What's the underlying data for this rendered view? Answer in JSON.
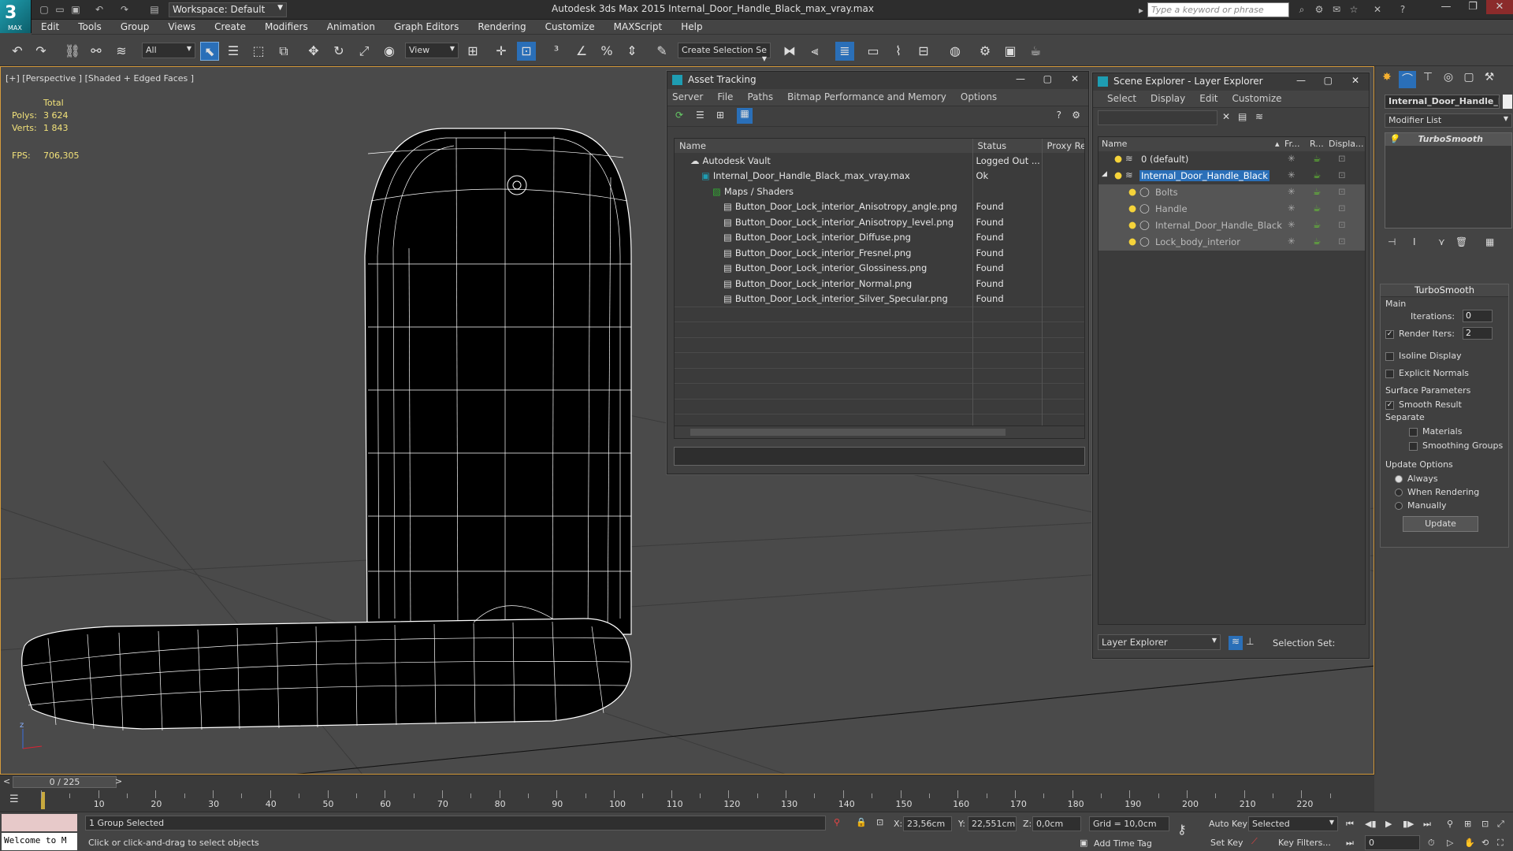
{
  "app": {
    "logo_text": "3",
    "logo_sub": "MAX",
    "title": "Autodesk 3ds Max  2015    Internal_Door_Handle_Black_max_vray.max",
    "workspace": "Workspace: Default",
    "search_placeholder": "Type a keyword or phrase"
  },
  "menubar": [
    "Edit",
    "Tools",
    "Group",
    "Views",
    "Create",
    "Modifiers",
    "Animation",
    "Graph Editors",
    "Rendering",
    "Customize",
    "MAXScript",
    "Help"
  ],
  "toolbar": {
    "filter_value": "All",
    "refcoord_value": "View",
    "selection_set_value": "Create Selection Se"
  },
  "viewport": {
    "label": "[+] [Perspective ] [Shaded + Edged Faces ]",
    "stats_header": "Total",
    "polys_label": "Polys:",
    "polys_value": "3 624",
    "verts_label": "Verts:",
    "verts_value": "1 843",
    "fps_label": "FPS:",
    "fps_value": "706,305"
  },
  "asset_tracking": {
    "title": "Asset Tracking",
    "menu": [
      "Server",
      "File",
      "Paths",
      "Bitmap Performance and Memory",
      "Options"
    ],
    "columns": [
      "Name",
      "Status",
      "Proxy Res"
    ],
    "rows": [
      {
        "name": "Autodesk Vault",
        "status": "Logged Out ...",
        "indent": 1
      },
      {
        "name": "Internal_Door_Handle_Black_max_vray.max",
        "status": "Ok",
        "indent": 2
      },
      {
        "name": "Maps / Shaders",
        "status": "",
        "indent": 3
      },
      {
        "name": "Button_Door_Lock_interior_Anisotropy_angle.png",
        "status": "Found",
        "indent": 4
      },
      {
        "name": "Button_Door_Lock_interior_Anisotropy_level.png",
        "status": "Found",
        "indent": 4
      },
      {
        "name": "Button_Door_Lock_interior_Diffuse.png",
        "status": "Found",
        "indent": 4
      },
      {
        "name": "Button_Door_Lock_interior_Fresnel.png",
        "status": "Found",
        "indent": 4
      },
      {
        "name": "Button_Door_Lock_interior_Glossiness.png",
        "status": "Found",
        "indent": 4
      },
      {
        "name": "Button_Door_Lock_interior_Normal.png",
        "status": "Found",
        "indent": 4
      },
      {
        "name": "Button_Door_Lock_interior_Silver_Specular.png",
        "status": "Found",
        "indent": 4
      }
    ]
  },
  "scene_explorer": {
    "title": "Scene Explorer - Layer Explorer",
    "menu": [
      "Select",
      "Display",
      "Edit",
      "Customize"
    ],
    "columns": [
      "Name",
      "Fr...",
      "R...",
      "Displa..."
    ],
    "rows": [
      {
        "name": "0 (default)",
        "level": 0,
        "selected": false,
        "group": false
      },
      {
        "name": "Internal_Door_Handle_Black",
        "level": 0,
        "selected": true,
        "group": false
      },
      {
        "name": "Bolts",
        "level": 1,
        "selected": false,
        "group": true
      },
      {
        "name": "Handle",
        "level": 1,
        "selected": false,
        "group": true
      },
      {
        "name": "Internal_Door_Handle_Black",
        "level": 1,
        "selected": false,
        "group": true
      },
      {
        "name": "Lock_body_interior",
        "level": 1,
        "selected": false,
        "group": true
      }
    ],
    "footer_dropdown": "Layer Explorer",
    "selection_set_label": "Selection Set:"
  },
  "command_panel": {
    "object_name": "Internal_Door_Handle_B",
    "modifier_list": "Modifier List",
    "stack_item": "TurboSmooth",
    "rollout_title": "TurboSmooth",
    "main_label": "Main",
    "iterations_label": "Iterations:",
    "iterations_value": "0",
    "render_iters_label": "Render Iters:",
    "render_iters_value": "2",
    "isoline": "Isoline Display",
    "explicit_normals": "Explicit Normals",
    "surface_params": "Surface Parameters",
    "smooth_result": "Smooth Result",
    "separate": "Separate",
    "materials": "Materials",
    "smoothing_groups": "Smoothing Groups",
    "update_options": "Update Options",
    "always": "Always",
    "when_rendering": "When Rendering",
    "manually": "Manually",
    "update_button": "Update"
  },
  "timeline": {
    "frame_display": "0 / 225",
    "ticks": [
      "10",
      "20",
      "30",
      "40",
      "50",
      "60",
      "70",
      "80",
      "90",
      "100",
      "110",
      "120",
      "130",
      "140",
      "150",
      "160",
      "170",
      "180",
      "190",
      "200",
      "210",
      "220"
    ]
  },
  "status": {
    "maxscript_text": "Welcome to M",
    "selection_text": "1 Group Selected",
    "prompt_text": "Click or click-and-drag to select objects",
    "x_label": "X:",
    "x_value": "23,56cm",
    "y_label": "Y:",
    "y_value": "22,551cm",
    "z_label": "Z:",
    "z_value": "0,0cm",
    "grid_text": "Grid = 10,0cm",
    "add_time_tag": "Add Time Tag",
    "auto_key": "Auto Key",
    "set_key": "Set Key",
    "key_mode_value": "Selected",
    "key_filters": "Key Filters...",
    "frame_value": "0"
  },
  "colors": {
    "accent": "#d49a3c",
    "selection": "#2a6fb8",
    "found": "#e6e6e6"
  }
}
